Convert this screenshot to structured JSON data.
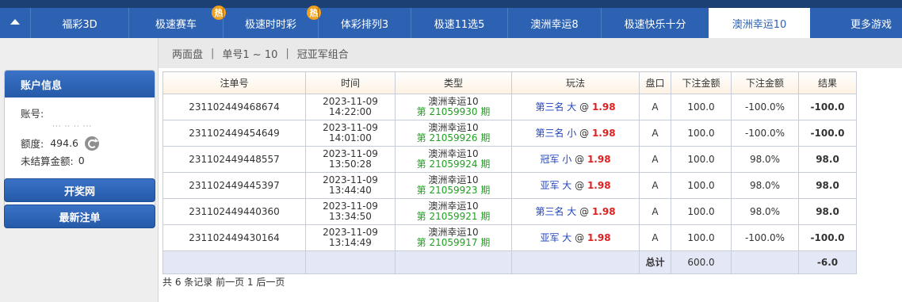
{
  "nav": {
    "tabs": [
      {
        "label": "福彩3D",
        "hot": false,
        "active": false
      },
      {
        "label": "极速赛车",
        "hot": true,
        "hot_label": "热",
        "active": false
      },
      {
        "label": "极速时时彩",
        "hot": true,
        "hot_label": "热",
        "active": false
      },
      {
        "label": "体彩排列3",
        "hot": false,
        "active": false
      },
      {
        "label": "极速11选5",
        "hot": false,
        "active": false
      },
      {
        "label": "澳洲幸运8",
        "hot": false,
        "active": false
      },
      {
        "label": "极速快乐十分",
        "hot": false,
        "active": false
      },
      {
        "label": "澳洲幸运10",
        "hot": false,
        "active": true
      }
    ],
    "more_label": "更多游戏"
  },
  "subnav": {
    "items": [
      "两面盘",
      "单号1 ~ 10",
      "冠亚军组合"
    ],
    "separator": "|"
  },
  "account": {
    "title": "账户信息",
    "account_label": "账号:",
    "masked_value": "··· ·· ·· ···",
    "balance_label": "额度:",
    "balance_value": "494.6",
    "unsettled_label": "未结算金额:",
    "unsettled_value": "0"
  },
  "sidebar_buttons": {
    "lottery_site": "开奖网",
    "latest_bets": "最新注单"
  },
  "table": {
    "headers": [
      "注单号",
      "时间",
      "类型",
      "玩法",
      "盘口",
      "下注金额",
      "下注金额",
      "结果"
    ],
    "rows": [
      {
        "id": "231102449468674",
        "date": "2023-11-09",
        "time": "14:22:00",
        "game": "澳洲幸运10",
        "period": "第 21059930 期",
        "play": "第三名 大",
        "at": "@",
        "odds": "1.98",
        "pan": "A",
        "amount": "100.0",
        "rate": "-100.0%",
        "result": "-100.0",
        "result_sign": "neg"
      },
      {
        "id": "231102449454649",
        "date": "2023-11-09",
        "time": "14:01:00",
        "game": "澳洲幸运10",
        "period": "第 21059926 期",
        "play": "第三名 小",
        "at": "@",
        "odds": "1.98",
        "pan": "A",
        "amount": "100.0",
        "rate": "-100.0%",
        "result": "-100.0",
        "result_sign": "neg"
      },
      {
        "id": "231102449448557",
        "date": "2023-11-09",
        "time": "13:50:28",
        "game": "澳洲幸运10",
        "period": "第 21059924 期",
        "play": "冠军 小",
        "at": "@",
        "odds": "1.98",
        "pan": "A",
        "amount": "100.0",
        "rate": "98.0%",
        "result": "98.0",
        "result_sign": "pos"
      },
      {
        "id": "231102449445397",
        "date": "2023-11-09",
        "time": "13:44:40",
        "game": "澳洲幸运10",
        "period": "第 21059923 期",
        "play": "亚军 大",
        "at": "@",
        "odds": "1.98",
        "pan": "A",
        "amount": "100.0",
        "rate": "98.0%",
        "result": "98.0",
        "result_sign": "pos"
      },
      {
        "id": "231102449440360",
        "date": "2023-11-09",
        "time": "13:34:50",
        "game": "澳洲幸运10",
        "period": "第 21059921 期",
        "play": "第三名 大",
        "at": "@",
        "odds": "1.98",
        "pan": "A",
        "amount": "100.0",
        "rate": "98.0%",
        "result": "98.0",
        "result_sign": "pos"
      },
      {
        "id": "231102449430164",
        "date": "2023-11-09",
        "time": "13:14:49",
        "game": "澳洲幸运10",
        "period": "第 21059917 期",
        "play": "亚军 大",
        "at": "@",
        "odds": "1.98",
        "pan": "A",
        "amount": "100.0",
        "rate": "-100.0%",
        "result": "-100.0",
        "result_sign": "neg"
      }
    ],
    "total": {
      "label": "总计",
      "amount": "600.0",
      "result": "-6.0"
    }
  },
  "pager": {
    "text": "共 6 条记录 前一页 1 后一页"
  }
}
